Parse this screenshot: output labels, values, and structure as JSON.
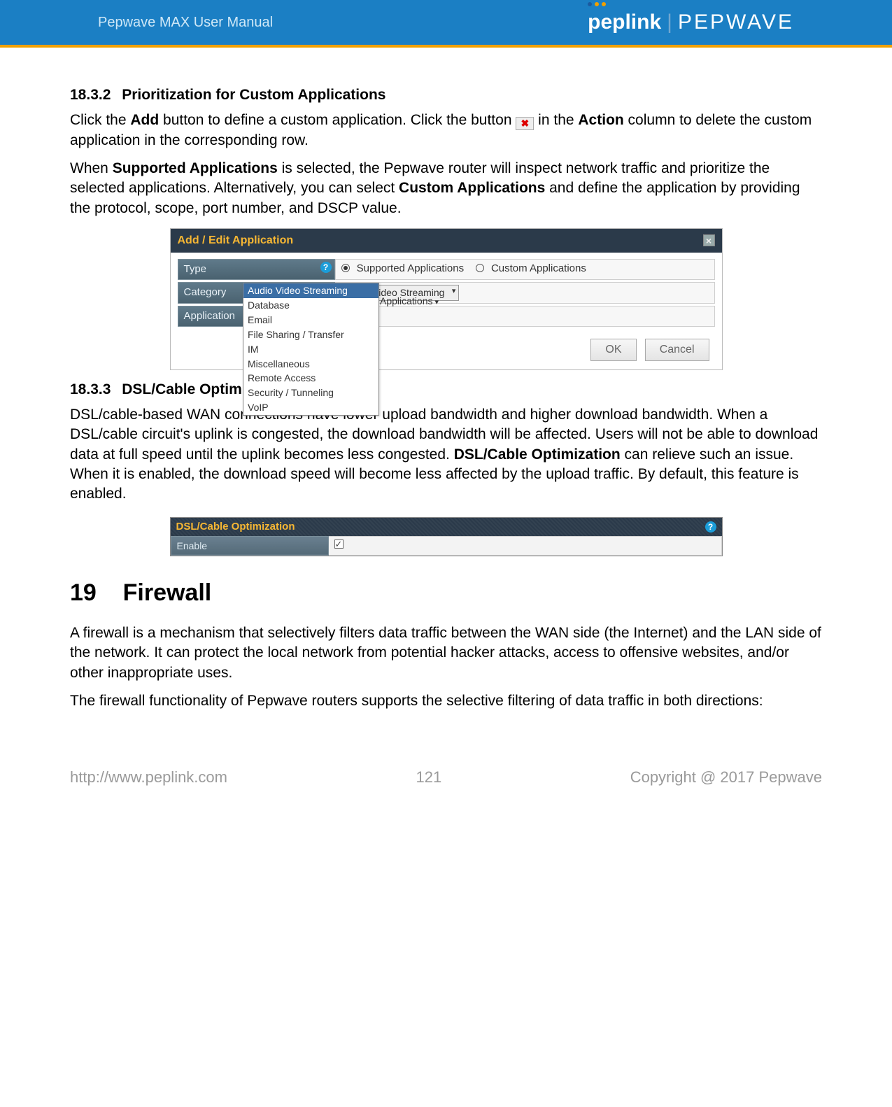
{
  "header": {
    "manual_title": "Pepwave MAX User Manual",
    "brand_left": "peplink",
    "brand_right": "PEPWAVE"
  },
  "section_18_3_2": {
    "number": "18.3.2",
    "title": "Prioritization for Custom Applications",
    "para1_a": "Click the ",
    "para1_b_bold": "Add",
    "para1_c": " button to define a custom application. Click the button ",
    "para1_d": " in the ",
    "para1_e_bold": "Action",
    "para1_f": " column to delete the custom application in the corresponding row.",
    "para2_a": "When ",
    "para2_b_bold": "Supported Applications",
    "para2_c": " is selected, the Pepwave router will inspect network traffic and prioritize the selected applications. Alternatively, you can select ",
    "para2_d_bold": "Custom Applications",
    "para2_e": " and define the application by providing the protocol, scope, port number, and DSCP value."
  },
  "app_panel": {
    "title": "Add / Edit Application",
    "rows": {
      "type_label": "Type",
      "type_opt_supported": "Supported Applications",
      "type_opt_custom": "Custom Applications",
      "category_label": "Category",
      "category_value": "Audio Video Streaming",
      "application_label": "Application",
      "application_right_hint": "Applications"
    },
    "dropdown_items": [
      "Audio Video Streaming",
      "Database",
      "Email",
      "File Sharing / Transfer",
      "IM",
      "Miscellaneous",
      "Remote Access",
      "Security / Tunneling",
      "VoIP"
    ],
    "buttons": {
      "ok": "OK",
      "cancel": "Cancel"
    }
  },
  "section_18_3_3": {
    "number": "18.3.3",
    "title": "DSL/Cable Optimization",
    "para_a": "DSL/cable-based WAN connections have lower upload bandwidth and higher download bandwidth. When a DSL/cable circuit's uplink is congested, the download bandwidth will be affected. Users will not be able to download data at full speed until the uplink becomes less congested. ",
    "para_b_bold": "DSL/Cable Optimization",
    "para_c": " can relieve such an issue. When it is enabled, the download speed will become less affected by the upload traffic. By default, this feature is enabled."
  },
  "dsl_panel": {
    "title": "DSL/Cable Optimization",
    "enable_label": "Enable"
  },
  "chapter_19": {
    "number": "19",
    "title": "Firewall",
    "para1": "A firewall is a mechanism that selectively filters data traffic between the WAN side (the Internet) and the LAN side of the network. It can protect the local network from potential hacker attacks, access to offensive websites, and/or other inappropriate uses.",
    "para2": "The firewall functionality of Pepwave routers supports the selective filtering of data traffic in both directions:"
  },
  "footer": {
    "url": "http://www.peplink.com",
    "page": "121",
    "copyright": "Copyright @ 2017 Pepwave"
  }
}
